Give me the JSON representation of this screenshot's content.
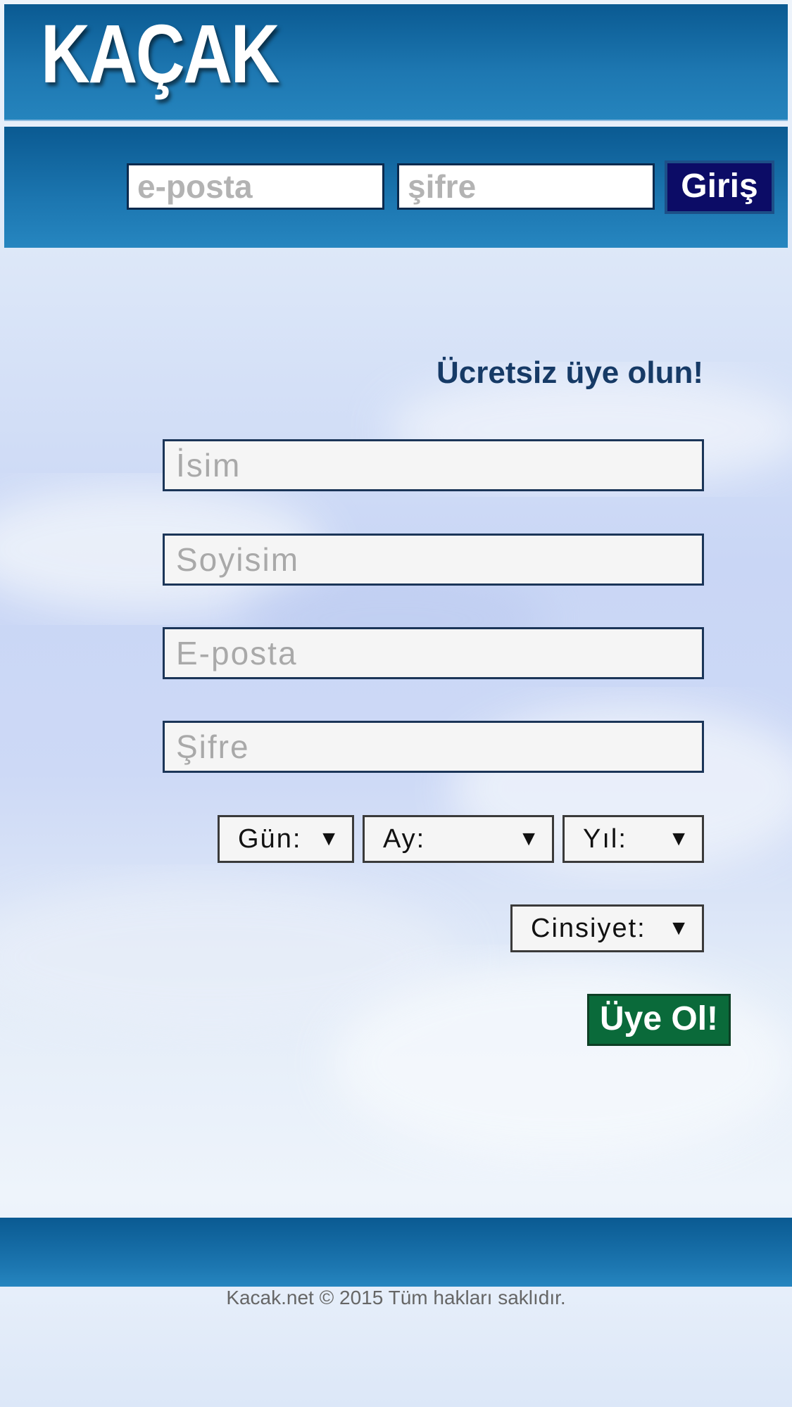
{
  "header": {
    "logo_text": "KAÇAK"
  },
  "login": {
    "email_placeholder": "e-posta",
    "password_placeholder": "şifre",
    "submit_label": "Giriş"
  },
  "register": {
    "title": "Ücretsiz üye olun!",
    "first_name_placeholder": "İsim",
    "last_name_placeholder": "Soyisim",
    "email_placeholder": "E-posta",
    "password_placeholder": "Şifre",
    "day_select": "Gün:",
    "month_select": "Ay:",
    "year_select": "Yıl:",
    "gender_select": "Cinsiyet:",
    "dropdown_arrow": "▼",
    "submit_label": "Üye Ol!"
  },
  "footer": {
    "copyright": "Kacak.net © 2015 Tüm hakları saklıdır."
  },
  "colors": {
    "header_blue": "#0a5a92",
    "login_button": "#0c0c66",
    "signup_button": "#0a6a3a",
    "title_text": "#163a66"
  }
}
